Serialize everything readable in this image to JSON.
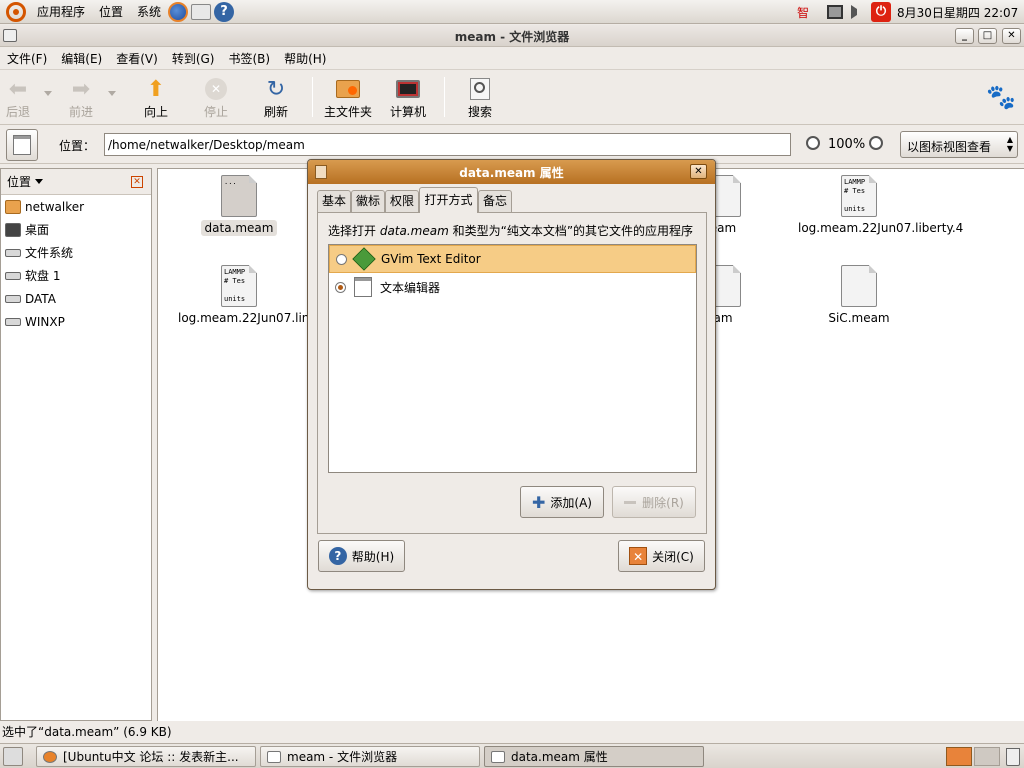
{
  "top_panel": {
    "menus": [
      "应用程序",
      "位置",
      "系统"
    ],
    "clock": "8月30日星期四 22:07",
    "tray_icons": [
      "input-method-icon",
      "network-icon",
      "volume-icon",
      "power-icon"
    ]
  },
  "window": {
    "title": "meam - 文件浏览器",
    "menu": [
      "文件(F)",
      "编辑(E)",
      "查看(V)",
      "转到(G)",
      "书签(B)",
      "帮助(H)"
    ],
    "toolbar": {
      "back": "后退",
      "forward": "前进",
      "up": "向上",
      "stop": "停止",
      "reload": "刷新",
      "home": "主文件夹",
      "computer": "计算机",
      "search": "搜索"
    },
    "location": {
      "label": "位置：",
      "path": "/home/netwalker/Desktop/meam",
      "zoom": "100%",
      "view_mode": "以图标视图查看"
    },
    "sidebar": {
      "header": "位置",
      "items": [
        "netwalker",
        "桌面",
        "文件系统",
        "软盘 1",
        "DATA",
        "WINXP"
      ]
    },
    "files": [
      {
        "name": "data.meam",
        "preview": "..."
      },
      {
        "name": "log.meam.22Jun07.linux.1",
        "preview": "LAMMP\n# Tes\n\nunits"
      },
      {
        "name": "eam",
        "preview": ""
      },
      {
        "name": "am",
        "preview": ""
      },
      {
        "name": "log.meam.22Jun07.liberty.4",
        "preview": "LAMMP\n# Tes\n\nunits"
      },
      {
        "name": "SiC.meam",
        "preview": ""
      }
    ],
    "status": "选中了“data.meam” (6.9 KB)"
  },
  "dialog": {
    "title": "data.meam 属性",
    "tabs": [
      "基本",
      "徽标",
      "权限",
      "打开方式",
      "备忘"
    ],
    "active_tab": "打开方式",
    "prompt_prefix": "选择打开 ",
    "prompt_file": "data.meam",
    "prompt_suffix": " 和类型为“纯文本文档”的其它文件的应用程序",
    "apps": [
      {
        "name": "GVim Text Editor",
        "selected": false,
        "highlighted": true
      },
      {
        "name": "文本编辑器",
        "selected": true,
        "highlighted": false
      }
    ],
    "add_label": "添加(A)",
    "remove_label": "删除(R)",
    "help_label": "帮助(H)",
    "close_label": "关闭(C)"
  },
  "taskbar": {
    "tasks": [
      "[Ubuntu中文 论坛 :: 发表新主...",
      "meam - 文件浏览器",
      "data.meam 属性"
    ]
  },
  "colors": {
    "dialog_title": "#c47f2f",
    "selection": "#f6cc86",
    "accent": "#d45500"
  }
}
